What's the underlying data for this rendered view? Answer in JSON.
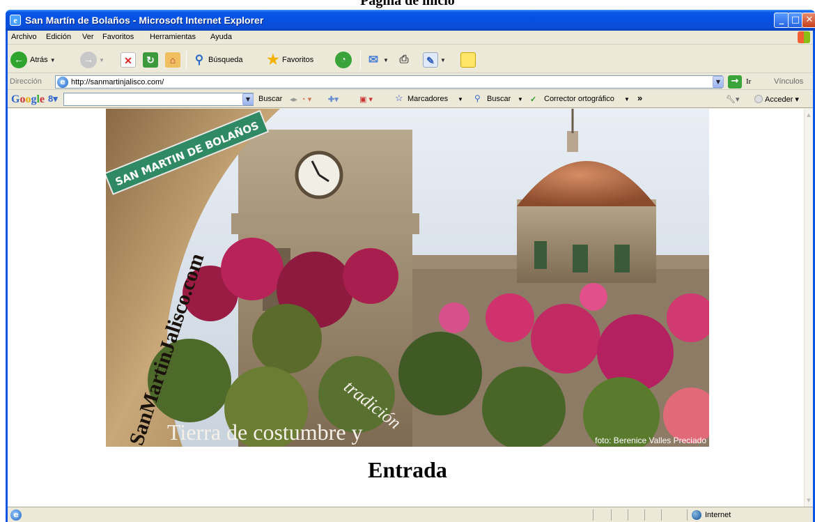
{
  "page_caption": "Página de inicio",
  "window": {
    "title": "San Martín de Bolaños - Microsoft Internet Explorer"
  },
  "menu": [
    "Archivo",
    "Edición",
    "Ver",
    "Favoritos",
    "Herramientas",
    "Ayuda"
  ],
  "toolbar": {
    "back_label": "Atrás",
    "search_label": "Búsqueda",
    "favorites_label": "Favoritos"
  },
  "address": {
    "label": "Dirección",
    "url": "http://sanmartinjalisco.com/",
    "go_label": "Ir",
    "links_label": "Vínculos"
  },
  "googlebar": {
    "logo": "Google",
    "search_label": "Buscar",
    "bookmarks_label": "Marcadores",
    "search2_label": "Buscar",
    "spell_label": "Corrector ortográfico",
    "more": "»",
    "signin_label": "Acceder"
  },
  "hero": {
    "street_sign": "SAN MARTIN DE BOLAÑOS",
    "site_name": "SanMartinJalisco.com",
    "tagline": "Tierra de costumbre y",
    "tagline_arc": "tradición",
    "photo_credit": "foto: Berenice Valles  Preciado"
  },
  "page": {
    "heading": "Entrada"
  },
  "status": {
    "zone": "Internet"
  }
}
